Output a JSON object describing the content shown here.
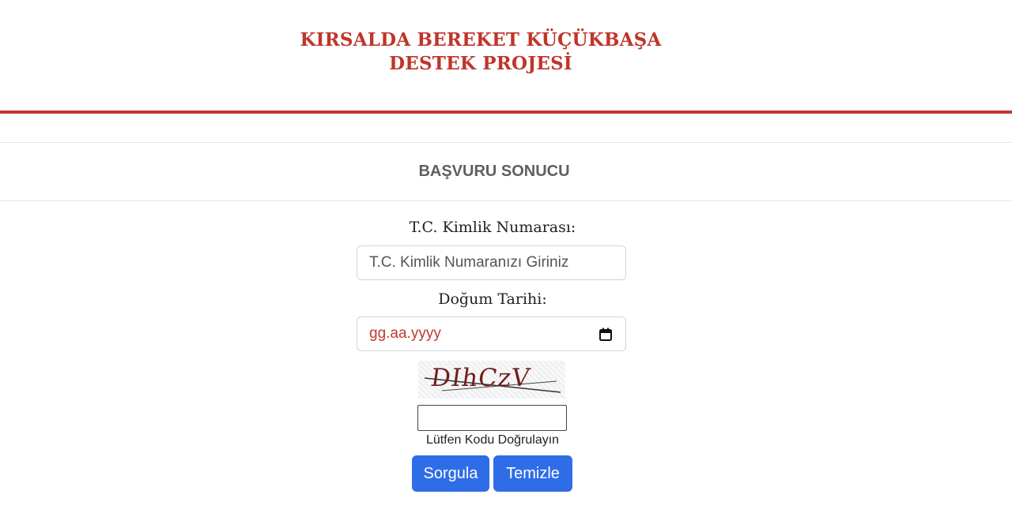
{
  "header": {
    "title_line1": "KIRSALDA BEREKET KÜÇÜKBAŞA",
    "title_line2": "DESTEK PROJESİ"
  },
  "card": {
    "title": "BAŞVURU SONUCU"
  },
  "form": {
    "tc_label": "T.C. Kimlik Numarası:",
    "tc_placeholder": "T.C. Kimlik Numaranızı Giriniz",
    "tc_value": "",
    "dob_label": "Doğum Tarihi:",
    "dob_placeholder": "gg.aa.yyyy",
    "captcha_text": "DIhCzV",
    "captcha_value": "",
    "captcha_hint": "Lütfen Kodu Doğrulayın",
    "submit_label": "Sorgula",
    "reset_label": "Temizle"
  },
  "colors": {
    "brand_red": "#c0352b",
    "button_blue": "#2f6de8"
  },
  "icons": {
    "date_picker": "calendar-icon"
  }
}
